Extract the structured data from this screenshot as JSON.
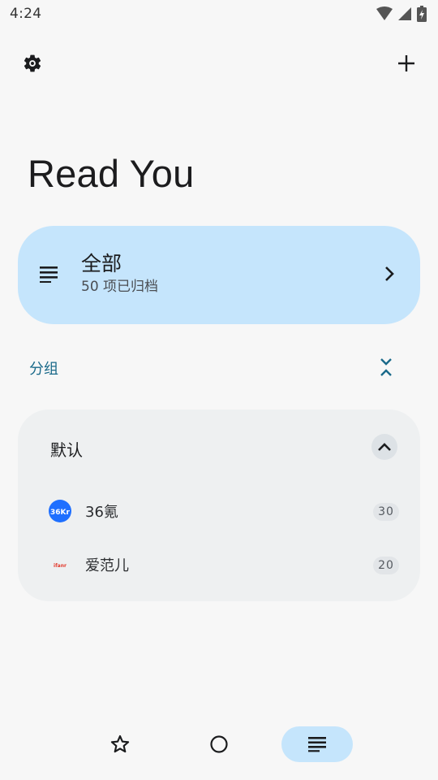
{
  "status_bar": {
    "time": "4:24"
  },
  "top_bar": {
    "settings_icon": "gear-icon",
    "add_icon": "plus-icon"
  },
  "title": "Read You",
  "all_card": {
    "title": "全部",
    "subtitle": "50 项已归档",
    "icon": "list-icon",
    "chevron": "chevron-right-icon",
    "background": "#c5e5fc"
  },
  "groups_section": {
    "label": "分组",
    "toggle_icon": "collapse-all-icon"
  },
  "group": {
    "name": "默认",
    "toggle_icon": "chevron-up-icon",
    "feeds": [
      {
        "name": "36氪",
        "count": "30",
        "avatar_text": "36Kr"
      },
      {
        "name": "爱范儿",
        "count": "20",
        "avatar_text": "ifanr"
      }
    ]
  },
  "bottom_nav": {
    "items": [
      {
        "name": "starred",
        "icon": "star-icon"
      },
      {
        "name": "unread",
        "icon": "circle-icon"
      },
      {
        "name": "all",
        "icon": "list-icon",
        "selected": true
      }
    ]
  }
}
